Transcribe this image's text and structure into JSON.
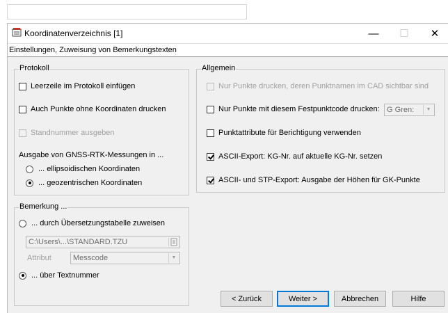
{
  "window": {
    "title": "Koordinatenverzeichnis [1]",
    "subtitle": "Einstellungen, Zuweisung von Bemerkungstexten",
    "minimize": "—",
    "maximize": "☐",
    "close": "✕"
  },
  "protokoll": {
    "legend": "Protokoll",
    "leerzeile": "Leerzeile im Protokoll einfügen",
    "punkte_ohne": "Auch Punkte ohne Koordinaten drucken",
    "standnummer": "Standnummer ausgeben",
    "gnss_label": "Ausgabe von GNSS-RTK-Messungen in ...",
    "ellipsoid": "... ellipsoidischen Koordinaten",
    "geozentrisch": "... geozentrischen Koordinaten"
  },
  "allgemein": {
    "legend": "Allgemein",
    "nur_cad": "Nur Punkte drucken, deren Punktnamen im CAD sichtbar sind",
    "festpunktcode": "Nur Punkte mit diesem Festpunktcode drucken:",
    "festpunktcode_value": "G   Gren:",
    "punktattribute": "Punktattribute für Berichtigung verwenden",
    "ascii_kg": "ASCII-Export: KG-Nr. auf aktuelle KG-Nr. setzen",
    "ascii_stp": "ASCII- und STP-Export: Ausgabe der Höhen für GK-Punkte"
  },
  "bemerkung": {
    "legend": "Bemerkung ...",
    "uebersetzung": "... durch Übersetzungstabelle zuweisen",
    "file_path": "C:\\Users\\...\\STANDARD.TZU",
    "attribut_label": "Attribut",
    "attribut_value": "Messcode",
    "textnummer": "... über Textnummer"
  },
  "buttons": {
    "back": "< Zurück",
    "next": "Weiter >",
    "cancel": "Abbrechen",
    "help": "Hilfe"
  }
}
